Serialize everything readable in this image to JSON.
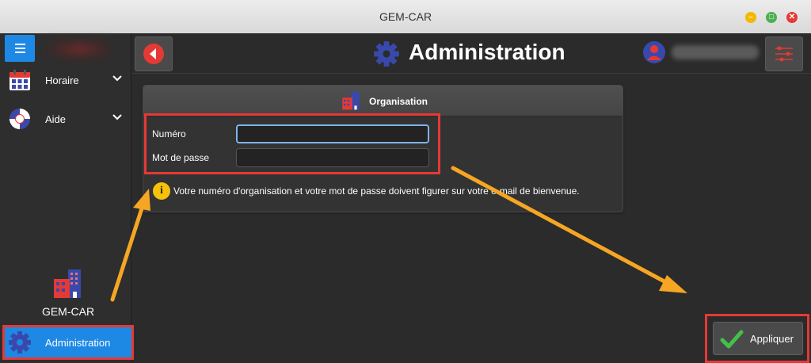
{
  "window": {
    "title": "GEM-CAR"
  },
  "sidebar": {
    "items": [
      {
        "label": "Horaire",
        "icon": "calendar-icon"
      },
      {
        "label": "Aide",
        "icon": "lifebuoy-icon"
      }
    ],
    "brand": "GEM-CAR",
    "active_item": "Administration"
  },
  "header": {
    "title": "Administration"
  },
  "panel": {
    "title": "Organisation",
    "fields": {
      "number_label": "Numéro",
      "number_value": "",
      "password_label": "Mot de passe",
      "password_value": ""
    },
    "info": "Votre numéro d'organisation et votre mot de passe doivent figurer sur votre e-mail de bienvenue."
  },
  "actions": {
    "apply_label": "Appliquer"
  },
  "colors": {
    "accent": "#1e88e5",
    "highlight": "#e53935",
    "arrow": "#f5a623",
    "success": "#43c04a"
  }
}
